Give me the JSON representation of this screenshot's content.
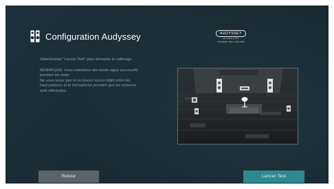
{
  "header": {
    "title": "Configuration Audyssey",
    "icon": "speaker-setup-icon",
    "brand": {
      "logo": "AUDYSSEY",
      "line1": "MULTEQ XT32",
      "line2": "DYNAMIC EQ & VOLUME"
    }
  },
  "content": {
    "instruction": "Sélectionnez \"Lancer Test\" pour démarrer le calibrage.",
    "note_lines": [
      "REMARQUE: Vous entendrez des bruits aigus successifs",
      "pendant les tests.",
      "Ne vous tenez pas et ne placez aucun objet entre les",
      "haut-parleurs et le microphone pendant que les mesures",
      "sont effectuées."
    ],
    "illustration": "speaker-room-illustration"
  },
  "footer": {
    "back_label": "Retour",
    "start_label": "Lancer Test"
  },
  "colors": {
    "background": "#1b2c35",
    "start_button": "#2e8a90",
    "back_button": "#5a6368",
    "title_text": "#ffffff",
    "body_text": "#8fa0a9"
  }
}
